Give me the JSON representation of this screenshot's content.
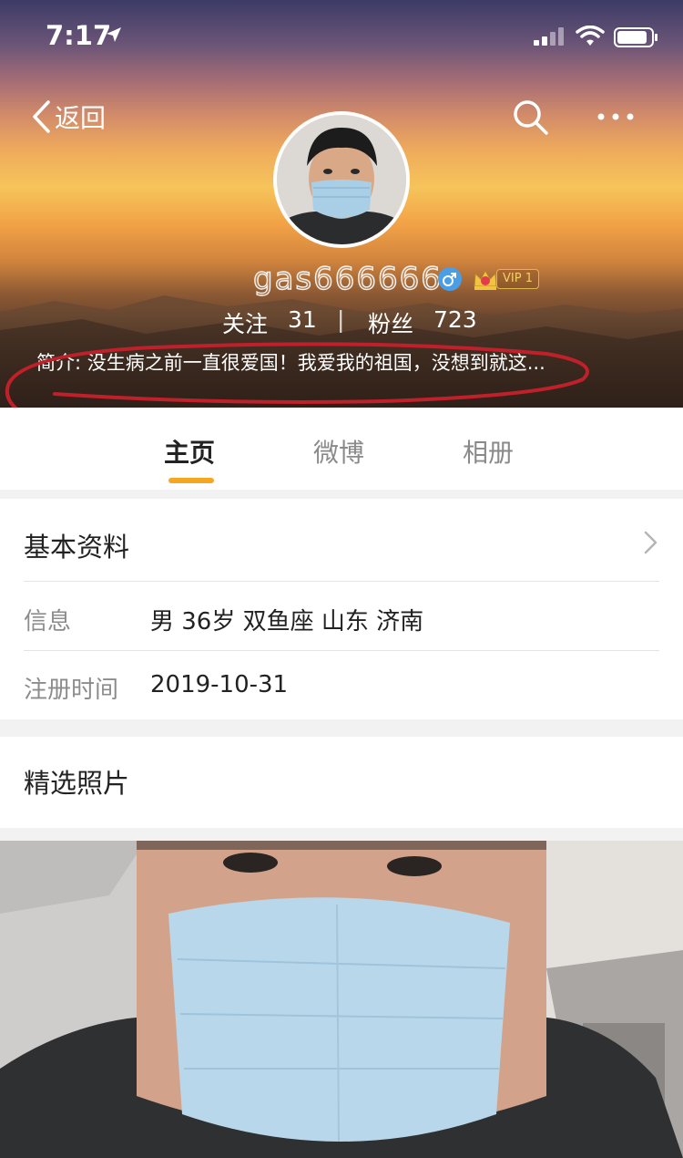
{
  "status_bar": {
    "time": "7:17"
  },
  "nav": {
    "back_label": "返回"
  },
  "profile": {
    "username": "gas666666",
    "vip_label": "VIP 1",
    "following_label": "关注",
    "following_count": "31",
    "separator": "|",
    "followers_label": "粉丝",
    "followers_count": "723",
    "bio": "简介: 没生病之前一直很爱国！我爱我的祖国，没想到就这..."
  },
  "tabs": [
    {
      "label": "主页",
      "active": true
    },
    {
      "label": "微博",
      "active": false
    },
    {
      "label": "相册",
      "active": false
    }
  ],
  "basic_info": {
    "title": "基本资料",
    "rows": [
      {
        "label": "信息",
        "value": "男  36岁  双鱼座  山东 济南"
      },
      {
        "label": "注册时间",
        "value": "2019-10-31"
      }
    ]
  },
  "featured_photos": {
    "title": "精选照片"
  },
  "colors": {
    "accent": "#f5a623",
    "annotation": "#c0202a",
    "vip_gold": "#e0b64a",
    "gender_blue": "#4a9ee6"
  },
  "icons": [
    "location-arrow-icon",
    "signal-icon",
    "wifi-icon",
    "battery-icon",
    "back-chevron-icon",
    "search-icon",
    "more-icon",
    "male-gender-icon",
    "vip-crown-icon",
    "chevron-right-icon"
  ]
}
